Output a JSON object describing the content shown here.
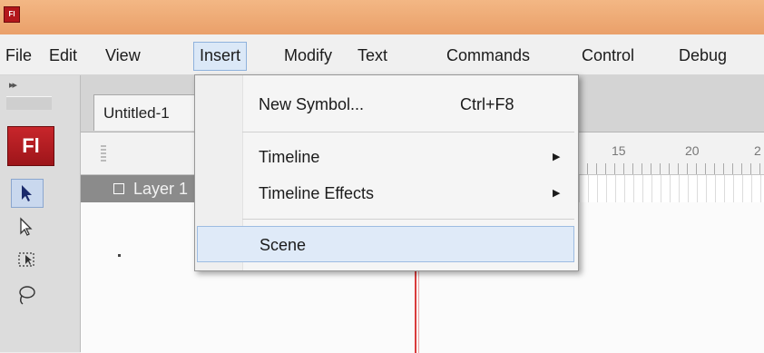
{
  "app": {
    "badge": "Fl",
    "logo": "Fl"
  },
  "menubar": {
    "items": [
      {
        "label": "File"
      },
      {
        "label": "Edit"
      },
      {
        "label": "View"
      },
      {
        "label": "Insert"
      },
      {
        "label": "Modify"
      },
      {
        "label": "Text"
      },
      {
        "label": "Commands"
      },
      {
        "label": "Control"
      },
      {
        "label": "Debug"
      }
    ],
    "active": "Insert"
  },
  "toolbar": {
    "collapse": "▸▸",
    "tools": [
      {
        "icon": "selection-arrow-icon",
        "selected": true
      },
      {
        "icon": "subselection-arrow-icon",
        "selected": false
      },
      {
        "icon": "free-transform-icon",
        "selected": false
      },
      {
        "icon": "lasso-icon",
        "selected": false
      }
    ]
  },
  "document": {
    "tab_title": "Untitled-1"
  },
  "timeline": {
    "frame_numbers": [
      "15",
      "20",
      "2"
    ],
    "layer_name": "Layer 1"
  },
  "insert_menu": {
    "new_symbol": {
      "label": "New Symbol...",
      "shortcut": "Ctrl+F8"
    },
    "timeline": {
      "label": "Timeline",
      "submenu": "▶"
    },
    "timeline_effects": {
      "label": "Timeline Effects",
      "submenu": "▶"
    },
    "scene": {
      "label": "Scene",
      "highlighted": true
    }
  },
  "colors": {
    "title_bar": "#eaa06a",
    "highlight": "#dfeaf8",
    "logo_red": "#b3171c",
    "playhead": "#d93c3c"
  }
}
